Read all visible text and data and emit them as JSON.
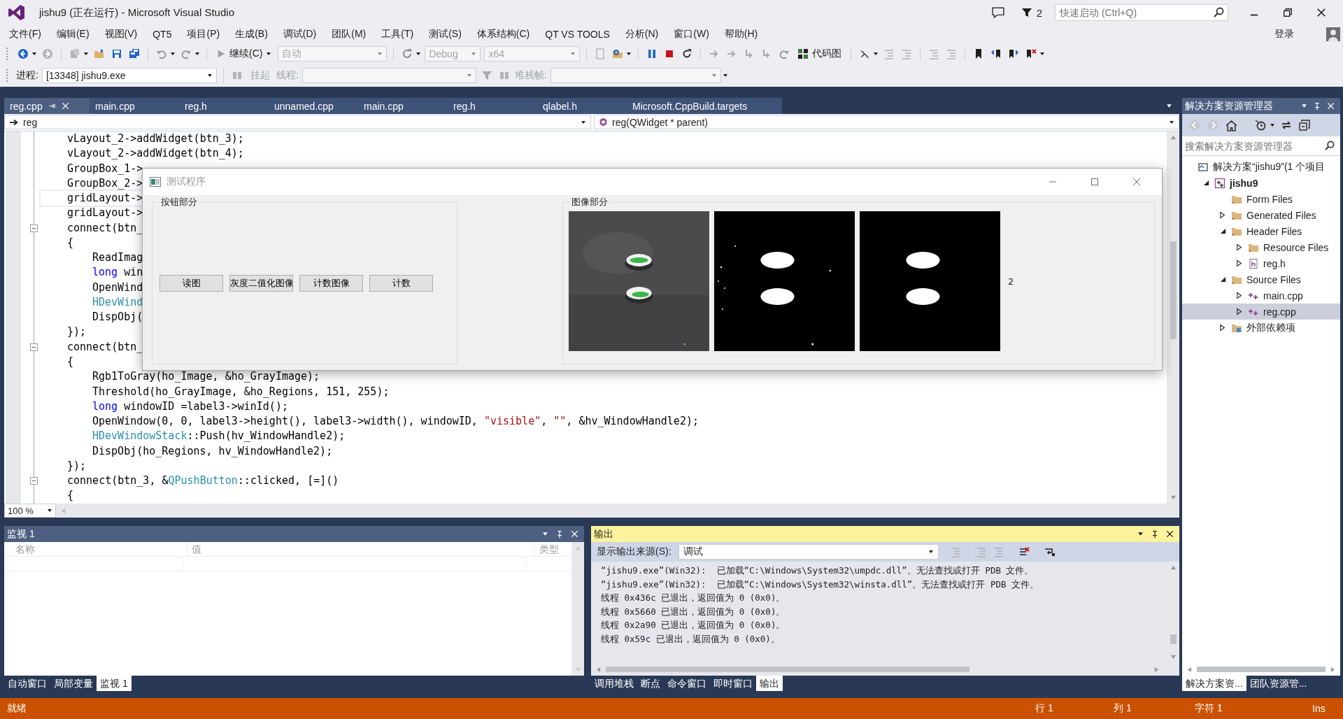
{
  "window": {
    "title": "jishu9 (正在运行) - Microsoft Visual Studio",
    "notification_count": "2",
    "quick_launch": {
      "placeholder": "快速启动 (Ctrl+Q)"
    }
  },
  "menu": [
    "文件(F)",
    "编辑(E)",
    "视图(V)",
    "QT5",
    "项目(P)",
    "生成(B)",
    "调试(D)",
    "团队(M)",
    "工具(T)",
    "测试(S)",
    "体系结构(C)",
    "QT VS TOOLS",
    "分析(N)",
    "窗口(W)",
    "帮助(H)"
  ],
  "account": "登录",
  "toolbar": {
    "continue": "继续(C)",
    "combos": [
      {
        "value": "自动",
        "disabled": true
      },
      {
        "value": "Debug",
        "disabled": true
      },
      {
        "value": "x64",
        "disabled": true
      }
    ],
    "code_map": "代码图"
  },
  "debug_location": {
    "process_label": "进程:",
    "process": "[13348] jishu9.exe",
    "suspend": "挂起",
    "thread_label": "线程:",
    "stack_frame_label": "堆栈帧:"
  },
  "document_tabs": [
    {
      "label": "reg.cpp",
      "selected": true
    },
    {
      "label": "main.cpp",
      "selected": false
    },
    {
      "label": "reg.h",
      "selected": false
    },
    {
      "label": "unnamed.cpp",
      "selected": false
    },
    {
      "label": "main.cpp",
      "selected": false
    },
    {
      "label": "reg.h",
      "selected": false
    },
    {
      "label": "qlabel.h",
      "selected": false
    },
    {
      "label": "Microsoft.CppBuild.targets",
      "selected": false
    }
  ],
  "navigation": {
    "scope": "reg",
    "member": "reg(QWidget * parent)"
  },
  "editor": {
    "zoom": "100 %",
    "lines": [
      {
        "parts": [
          {
            "text": "vLayout_2->addWidget(btn_3);",
            "kind": "code"
          }
        ],
        "indented": false,
        "fold": false,
        "current": false
      },
      {
        "parts": [
          {
            "text": "vLayout_2->addWidget(btn_4);",
            "kind": "code"
          }
        ],
        "indented": false,
        "fold": false,
        "current": false
      },
      {
        "parts": [
          {
            "text": "GroupBox_1->",
            "kind": "code"
          }
        ],
        "indented": false,
        "fold": false,
        "current": false
      },
      {
        "parts": [
          {
            "text": "GroupBox_2->",
            "kind": "code"
          }
        ],
        "indented": false,
        "fold": false,
        "current": false
      },
      {
        "parts": [
          {
            "text": "gridLayout->",
            "kind": "code"
          }
        ],
        "indented": false,
        "fold": false,
        "current": true
      },
      {
        "parts": [
          {
            "text": "gridLayout->",
            "kind": "code"
          }
        ],
        "indented": false,
        "fold": false,
        "current": false
      },
      {
        "parts": [
          {
            "text": "connect(btn_",
            "kind": "code"
          }
        ],
        "indented": false,
        "fold": true,
        "current": false
      },
      {
        "parts": [
          {
            "text": "{",
            "kind": "code"
          }
        ],
        "indented": false,
        "fold": false,
        "current": false
      },
      {
        "parts": [
          {
            "text": "ReadImag",
            "kind": "code"
          }
        ],
        "indented": true,
        "fold": false,
        "current": false
      },
      {
        "parts": [
          {
            "text": "long",
            "kind": "keyword"
          },
          {
            "text": " win",
            "kind": "code"
          }
        ],
        "indented": true,
        "fold": false,
        "current": false
      },
      {
        "parts": [
          {
            "text": "OpenWind",
            "kind": "code"
          }
        ],
        "indented": true,
        "fold": false,
        "current": false
      },
      {
        "parts": [
          {
            "text": "HDevWind",
            "kind": "type"
          }
        ],
        "indented": true,
        "fold": false,
        "current": false
      },
      {
        "parts": [
          {
            "text": "DispObj(",
            "kind": "code"
          }
        ],
        "indented": true,
        "fold": false,
        "current": false
      },
      {
        "parts": [
          {
            "text": "});",
            "kind": "code"
          }
        ],
        "indented": false,
        "fold": false,
        "current": false
      },
      {
        "parts": [
          {
            "text": "connect(btn_",
            "kind": "code"
          }
        ],
        "indented": false,
        "fold": true,
        "current": false
      },
      {
        "parts": [
          {
            "text": "{",
            "kind": "code"
          }
        ],
        "indented": false,
        "fold": false,
        "current": false
      },
      {
        "parts": [
          {
            "text": "Rgb1ToGray(ho_Image, &ho_GrayImage);",
            "kind": "code"
          }
        ],
        "indented": true,
        "fold": false,
        "current": false
      },
      {
        "parts": [
          {
            "text": "Threshold(ho_GrayImage, &ho_Regions, 151, 255);",
            "kind": "code"
          }
        ],
        "indented": true,
        "fold": false,
        "current": false
      },
      {
        "parts": [
          {
            "text": "long",
            "kind": "keyword"
          },
          {
            "text": " windowID =label3->winId();",
            "kind": "code"
          }
        ],
        "indented": true,
        "fold": false,
        "current": false
      },
      {
        "parts": [
          {
            "text": "OpenWindow(0, 0, label3->height(), label3->width(), windowID, ",
            "kind": "code"
          },
          {
            "text": "\"visible\"",
            "kind": "string"
          },
          {
            "text": ", ",
            "kind": "code"
          },
          {
            "text": "\"\"",
            "kind": "string"
          },
          {
            "text": ", &hv_WindowHandle2);",
            "kind": "code"
          }
        ],
        "indented": true,
        "fold": false,
        "current": false
      },
      {
        "parts": [
          {
            "text": "HDevWindowStack",
            "kind": "type"
          },
          {
            "text": "::Push(hv_WindowHandle2);",
            "kind": "code"
          }
        ],
        "indented": true,
        "fold": false,
        "current": false
      },
      {
        "parts": [
          {
            "text": "DispObj(ho_Regions, hv_WindowHandle2);",
            "kind": "code"
          }
        ],
        "indented": true,
        "fold": false,
        "current": false
      },
      {
        "parts": [
          {
            "text": "});",
            "kind": "code"
          }
        ],
        "indented": false,
        "fold": false,
        "current": false
      },
      {
        "parts": [
          {
            "text": "connect(btn_3, &",
            "kind": "code"
          },
          {
            "text": "QPushButton",
            "kind": "type"
          },
          {
            "text": "::clicked, [=]()",
            "kind": "code"
          }
        ],
        "indented": false,
        "fold": true,
        "current": false
      },
      {
        "parts": [
          {
            "text": "{",
            "kind": "code"
          }
        ],
        "indented": false,
        "fold": false,
        "current": false
      }
    ]
  },
  "dialog": {
    "title": "测试程序",
    "button_group": {
      "title": "按钮部分",
      "buttons": [
        "读图",
        "灰度二值化图像",
        "计数图像",
        "计数"
      ]
    },
    "image_group": {
      "title": "图像部分",
      "count": "2"
    }
  },
  "solution_explorer": {
    "title": "解决方案资源管理器",
    "search": {
      "placeholder": "搜索解决方案资源管理器"
    },
    "tree": [
      {
        "label": "解决方案“jishu9”(1 个项目",
        "kind": "solution",
        "selected": false,
        "children": [
          {
            "label": "jishu9",
            "kind": "project",
            "expanded": true,
            "selected": false,
            "children": [
              {
                "label": "Form Files",
                "kind": "folder",
                "selected": false
              },
              {
                "label": "Generated Files",
                "kind": "folder",
                "expanded": false,
                "selected": false
              },
              {
                "label": "Header Files",
                "kind": "folder",
                "expanded": true,
                "selected": false,
                "children": [
                  {
                    "label": "Resource Files",
                    "kind": "folder",
                    "expanded": false,
                    "selected": false
                  },
                  {
                    "label": "reg.h",
                    "kind": "header",
                    "expanded": false,
                    "selected": false
                  }
                ]
              },
              {
                "label": "Source Files",
                "kind": "folder",
                "expanded": true,
                "selected": false,
                "children": [
                  {
                    "label": "main.cpp",
                    "kind": "source",
                    "expanded": false,
                    "selected": false
                  },
                  {
                    "label": "reg.cpp",
                    "kind": "source",
                    "expanded": false,
                    "selected": true
                  }
                ]
              },
              {
                "label": "外部依赖项",
                "kind": "references",
                "expanded": false,
                "selected": false
              }
            ]
          }
        ]
      }
    ],
    "tabs": [
      {
        "label": "解决方案资...",
        "selected": true
      },
      {
        "label": "团队资源管...",
        "selected": false
      }
    ]
  },
  "watch": {
    "title": "监视 1",
    "columns": [
      "名称",
      "值",
      "类型"
    ],
    "tabs": [
      {
        "label": "自动窗口",
        "selected": false
      },
      {
        "label": "局部变量",
        "selected": false
      },
      {
        "label": "监视 1",
        "selected": true
      }
    ]
  },
  "output": {
    "title": "输出",
    "source_label": "显示输出来源(S):",
    "source": "调试",
    "lines": [
      "“jishu9.exe”(Win32):  已加载“C:\\Windows\\System32\\umpdc.dll”。无法查找或打开 PDB 文件。",
      "“jishu9.exe”(Win32):  已加载“C:\\Windows\\System32\\winsta.dll”。无法查找或打开 PDB 文件。",
      "线程 0x436c 已退出，返回值为 0 (0x0)。",
      "线程 0x5660 已退出，返回值为 0 (0x0)。",
      "线程 0x2a90 已退出，返回值为 0 (0x0)。",
      "线程 0x59c 已退出，返回值为 0 (0x0)。"
    ],
    "tabs": [
      {
        "label": "调用堆栈",
        "selected": false
      },
      {
        "label": "断点",
        "selected": false
      },
      {
        "label": "命令窗口",
        "selected": false
      },
      {
        "label": "即时窗口",
        "selected": false
      },
      {
        "label": "输出",
        "selected": true
      }
    ]
  },
  "status_bar": {
    "message": "就绪",
    "line": "行 1",
    "column": "列 1",
    "char": "字符 1",
    "mode": "Ins"
  }
}
